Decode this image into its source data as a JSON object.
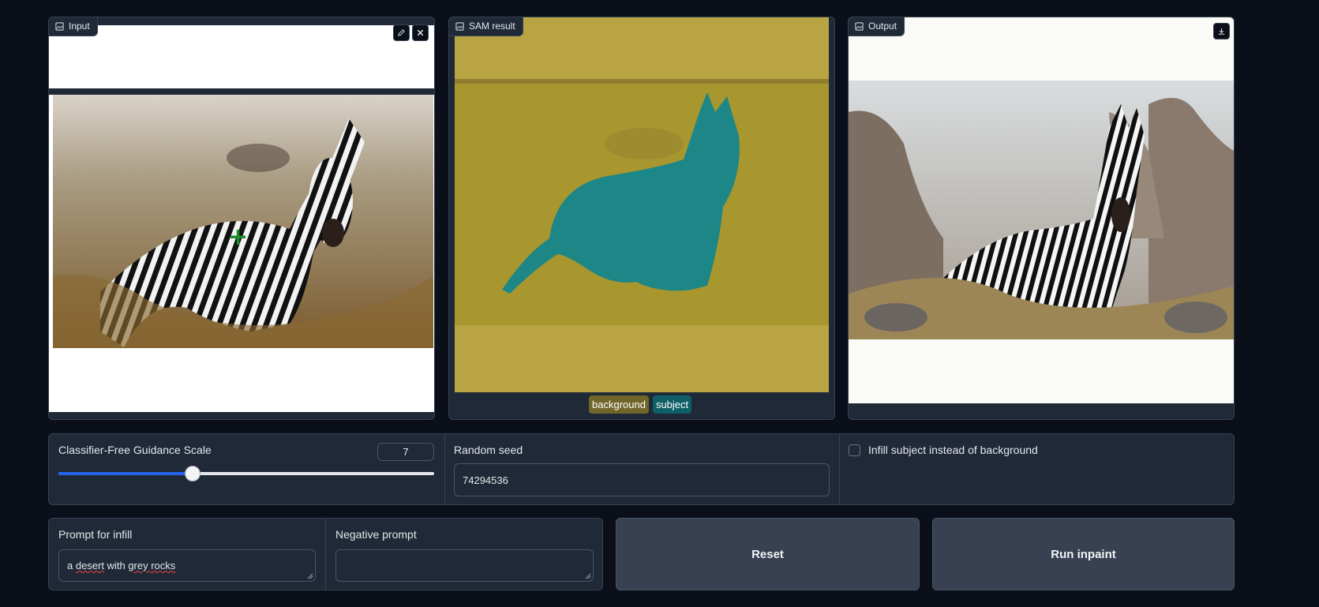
{
  "input_panel": {
    "label": "Input",
    "edit_icon": "pencil-icon",
    "close_icon": "close-icon"
  },
  "sam_panel": {
    "label": "SAM result",
    "legend": [
      {
        "label": "background",
        "color": "#71662a"
      },
      {
        "label": "subject",
        "color": "#0f5f66"
      }
    ]
  },
  "output_panel": {
    "label": "Output",
    "download_icon": "download-icon"
  },
  "cfg": {
    "label": "Classifier-Free Guidance Scale",
    "value": "7",
    "fraction": 0.35
  },
  "seed": {
    "label": "Random seed",
    "value": "74294536"
  },
  "infill_subject": {
    "label": "Infill subject instead of background",
    "checked": false
  },
  "prompt": {
    "label": "Prompt for infill",
    "value_parts": [
      "a ",
      "desert",
      " with ",
      "grey rocks"
    ]
  },
  "negative_prompt": {
    "label": "Negative prompt",
    "value": ""
  },
  "buttons": {
    "reset": "Reset",
    "run": "Run inpaint"
  },
  "colors": {
    "accent": "#2563eb",
    "panel": "#1f2937",
    "background": "#0b0f19"
  }
}
